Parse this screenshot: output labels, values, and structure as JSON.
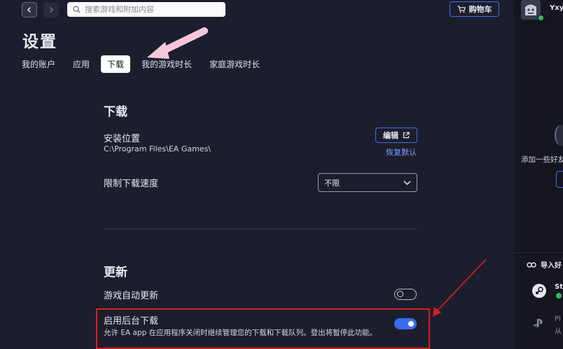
{
  "search": {
    "placeholder": "搜索游戏和附加内容"
  },
  "header": {
    "cart_label": "购物车"
  },
  "page": {
    "title": "设置"
  },
  "tabs": [
    {
      "label": "我的账户",
      "active": false
    },
    {
      "label": "应用",
      "active": false
    },
    {
      "label": "下载",
      "active": true
    },
    {
      "label": "我的游戏时长",
      "active": false
    },
    {
      "label": "家庭游戏时长",
      "active": false
    }
  ],
  "download": {
    "section_title": "下载",
    "install_location_label": "安装位置",
    "install_location_path": "C:\\Program Files\\EA Games\\",
    "edit_label": "编辑",
    "restore_default_label": "恢复默认",
    "speed_limit_label": "限制下载速度",
    "speed_limit_value": "不限"
  },
  "update": {
    "section_title": "更新",
    "auto_update_label": "游戏自动更新",
    "auto_update_enabled": false,
    "background_download_label": "启用后台下载",
    "background_download_desc": "允许 EA app 在应用程序关闭时继续管理您的下载和下载队列。登出将暂停此功能。",
    "background_download_enabled": true
  },
  "right_panel": {
    "username": "Yxy",
    "friend_hint": "添加一些好友",
    "import_label": "导入好",
    "steam_label": "St",
    "playstation_label": "Pl",
    "playstation_sub": "从"
  },
  "colors": {
    "background": "#1d1e2d",
    "accent_blue": "#3f6ee8",
    "toggle_on": "#3a6cf0",
    "highlight_red": "#d42020",
    "annotation_pink": "#f7c8dc",
    "online_green": "#2fbf5a"
  },
  "icons": {
    "back": "chevron-left-icon",
    "forward": "chevron-right-icon",
    "search": "search-icon",
    "cart": "cart-icon",
    "external": "external-link-icon",
    "dropdown": "chevron-down-icon",
    "link": "link-icon",
    "steam": "steam-icon",
    "playstation": "playstation-icon"
  }
}
